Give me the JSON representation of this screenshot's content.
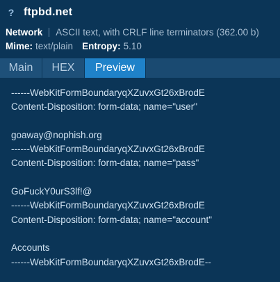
{
  "header": {
    "icon": "question-icon",
    "title": "ftpbd.net",
    "kind": "Network",
    "description": "ASCII text, with CRLF line terminators (362.00 b)",
    "mime_label": "Mime:",
    "mime_value": "text/plain",
    "entropy_label": "Entropy:",
    "entropy_value": "5.10"
  },
  "tabs": [
    {
      "label": "Main",
      "active": false
    },
    {
      "label": "HEX",
      "active": false
    },
    {
      "label": "Preview",
      "active": true
    }
  ],
  "preview": {
    "lines": [
      "------WebKitFormBoundaryqXZuvxGt26xBrodE",
      "Content-Disposition: form-data; name=\"user\"",
      "",
      "goaway@nophish.org",
      "------WebKitFormBoundaryqXZuvxGt26xBrodE",
      "Content-Disposition: form-data; name=\"pass\"",
      "",
      "GoFuckY0urS3lf!@",
      "------WebKitFormBoundaryqXZuvxGt26xBrodE",
      "Content-Disposition: form-data; name=\"account\"",
      "",
      "Accounts",
      "------WebKitFormBoundaryqXZuvxGt26xBrodE--"
    ]
  },
  "colors": {
    "background": "#0b3557",
    "active_tab": "#1f82c9",
    "tab": "#1e5079"
  }
}
